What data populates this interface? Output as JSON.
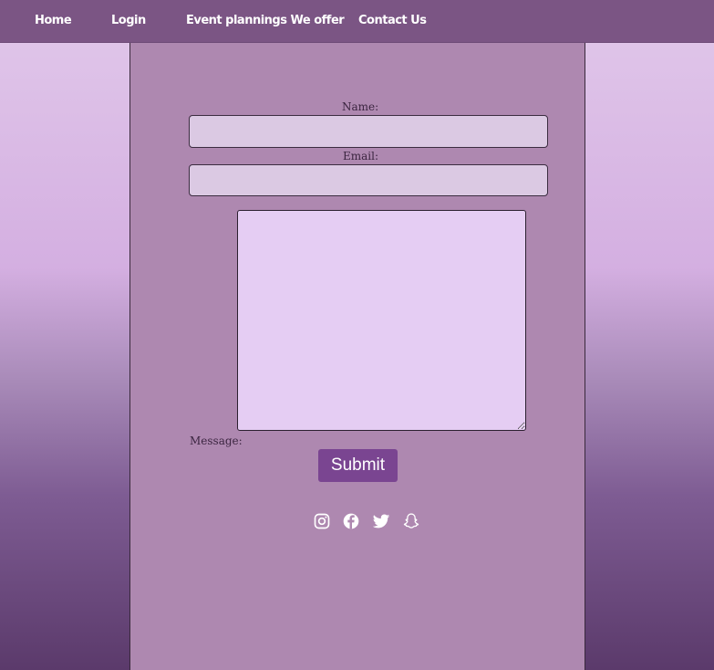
{
  "nav": {
    "home": "Home",
    "login": "Login",
    "events": "Event plannings We offer",
    "contact": "Contact Us"
  },
  "form": {
    "name_label": "Name:",
    "name_value": "",
    "email_label": "Email:",
    "email_value": "",
    "message_label": "Message:",
    "message_value": "",
    "submit_label": "Submit"
  },
  "social": [
    "instagram-icon",
    "facebook-icon",
    "twitter-icon",
    "snapchat-icon"
  ],
  "colors": {
    "navbar": "#7b5584",
    "panel": "#ae88b0",
    "button": "#7a4591",
    "input": "#dbc9e3",
    "textarea": "#e5cdf3"
  }
}
